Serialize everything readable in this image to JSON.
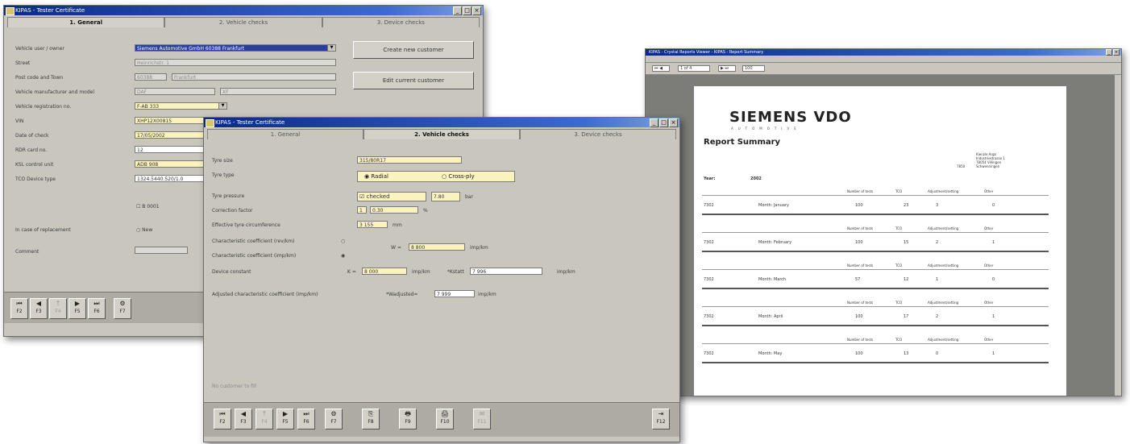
{
  "win1": {
    "title": "KIPAS - Tester Certificate",
    "tabs": [
      "1. General",
      "2. Vehicle checks",
      "3. Device checks"
    ],
    "labels": [
      "Vehicle user / owner",
      "Street",
      "Post code and Town",
      "Vehicle manufacturer and model",
      "Vehicle registration no.",
      "VIN",
      "Date of check",
      "RDR card no.",
      "KSL control unit",
      "TCO Device type",
      "In case of replacement",
      "Comment"
    ],
    "fields": {
      "owner": "Siemens Automotive GmbH 60388 Frankfurt",
      "street": "Heinrichstr. 1",
      "post": "60388",
      "town": "Frankfurt",
      "manufacturer": "DAF",
      "model": "XF",
      "registration": "F-AB 333",
      "vin": "XHP12X00815",
      "date": "17/05/2002",
      "rdr": "12",
      "ksl": "ADB 908",
      "tco": "1324.5440.520/1.0"
    },
    "checkbox": "B 0001",
    "radio": "New",
    "button_create": "Create new customer",
    "button_edit": "Edit current customer",
    "fkeys": [
      {
        "icon": "⏮",
        "label": "F2"
      },
      {
        "icon": "◀",
        "label": "F3"
      },
      {
        "icon": "↑",
        "label": "F4"
      },
      {
        "icon": "▶",
        "label": "F5"
      },
      {
        "icon": "⏭",
        "label": "F6"
      },
      {
        "icon": "⚙",
        "label": "F7"
      }
    ]
  },
  "win2": {
    "title": "KIPAS - Tester Certificate",
    "tabs": [
      "1. General",
      "2. Vehicle checks",
      "3. Device checks"
    ],
    "labels": [
      "Tyre size",
      "Tyre type",
      "Tyre pressure",
      "Correction factor",
      "Effective tyre circumference",
      "Characteristic coefficient (rev/km)",
      "Characteristic coefficient (imp/km)",
      "Device constant",
      "Adjusted characteristic coefficient (imp/km)"
    ],
    "tyre_size": "315/80R17",
    "radio_radial": "Radial",
    "radio_crossply": "Cross-ply",
    "pressure_check": "checked",
    "pressure_value": "7.80",
    "pressure_unit": "bar",
    "correction_a": "1",
    "correction_b": "0.30",
    "correction_unit": "%",
    "circumference": "3 155",
    "circumference_unit": "mm",
    "w_label": "W =",
    "w_value": "8 800",
    "w_unit": "imp/km",
    "k_label": "K =",
    "k_value": "8 000",
    "k_unit": "imp/km",
    "ktarif_label": "*Kstatt",
    "ktarif_value": "7 996",
    "ktarif_unit": "imp/km",
    "wadj_label": "*Wadjusted=",
    "wadj_value": "7 999",
    "wadj_unit": "imp/km",
    "footer_note": "No customer to fill",
    "fkeys": [
      {
        "icon": "⏮",
        "label": "F2"
      },
      {
        "icon": "◀",
        "label": "F3"
      },
      {
        "icon": "↑",
        "label": "F4"
      },
      {
        "icon": "▶",
        "label": "F5"
      },
      {
        "icon": "⏭",
        "label": "F6"
      },
      {
        "icon": "⚙",
        "label": "F7"
      },
      {
        "icon": "⎘",
        "label": "F8"
      },
      {
        "icon": "🖶",
        "label": "F9"
      },
      {
        "icon": "🖨",
        "label": "F10"
      },
      {
        "icon": "✉",
        "label": "F11"
      },
      {
        "icon": "⇥",
        "label": "F12"
      }
    ]
  },
  "win3": {
    "title": "KIPAS - Crystal Reports Viewer - KIPAS - Report Summary",
    "page_indicator": "1 of 4",
    "zoom": "100",
    "brand": "SIEMENS VDO",
    "brand_sub": "AUTOMOTIVE",
    "report_title": "Report Summary",
    "address": [
      "Kienzle Argo",
      "Industriestrasse 1",
      "78054 Villingen",
      "Schwenningen"
    ],
    "address_code": "7850",
    "year_label": "Year:",
    "year_value": "2002",
    "col_headers": [
      "Number of tests",
      "TCO",
      "Adjustment/setting",
      "Other"
    ],
    "rows": [
      {
        "code": "7302",
        "month": "Month: January",
        "vals": [
          "100",
          "23",
          "3",
          "0"
        ]
      },
      {
        "code": "7302",
        "month": "Month: February",
        "vals": [
          "100",
          "15",
          "2",
          "1"
        ]
      },
      {
        "code": "7302",
        "month": "Month: March",
        "vals": [
          "57",
          "12",
          "1",
          "0"
        ]
      },
      {
        "code": "7302",
        "month": "Month: April",
        "vals": [
          "100",
          "17",
          "2",
          "1"
        ]
      },
      {
        "code": "7302",
        "month": "Month: May",
        "vals": [
          "100",
          "13",
          "0",
          "1"
        ]
      }
    ]
  }
}
